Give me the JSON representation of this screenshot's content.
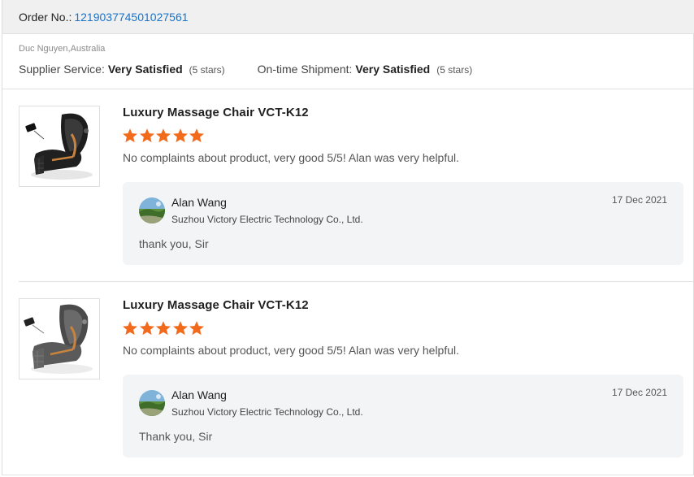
{
  "order": {
    "label": "Order No.:",
    "number": "121903774501027561"
  },
  "buyer": {
    "name_location": "Duc Nguyen,Australia"
  },
  "ratings": [
    {
      "label": "Supplier Service:",
      "value": "Very Satisfied",
      "stars_text": "(5 stars)"
    },
    {
      "label": "On-time Shipment:",
      "value": "Very Satisfied",
      "stars_text": "(5 stars)"
    }
  ],
  "reviews": [
    {
      "product_title": "Luxury Massage Chair VCT-K12",
      "star_rating": 5,
      "comment": "No complaints about product, very good 5/5! Alan was very helpful.",
      "reply": {
        "name": "Alan Wang",
        "company": "Suzhou Victory Electric Technology Co., Ltd.",
        "date": "17 Dec 2021",
        "text": "thank you, Sir"
      }
    },
    {
      "product_title": "Luxury Massage Chair VCT-K12",
      "star_rating": 5,
      "comment": "No complaints about product, very good 5/5! Alan was very helpful.",
      "reply": {
        "name": "Alan Wang",
        "company": "Suzhou Victory Electric Technology Co., Ltd.",
        "date": "17 Dec 2021",
        "text": "Thank you, Sir"
      }
    }
  ],
  "colors": {
    "star": "#f26a1b",
    "link": "#1a73c9",
    "header_bg": "#f0f0f0",
    "reply_bg": "#f3f4f6"
  },
  "icons": {
    "star": "star-icon",
    "chair_image": "massage-chair-image",
    "avatar": "avatar"
  }
}
